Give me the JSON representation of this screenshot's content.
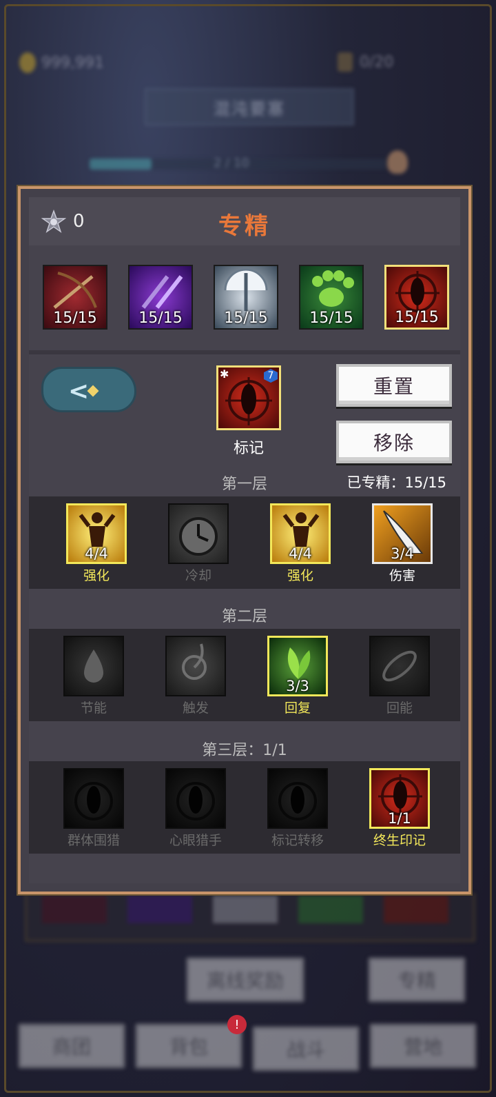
{
  "background": {
    "gold": "999,991",
    "bag": "0/20",
    "stage_title": "混沌要塞",
    "progress_text": "2 / 10",
    "progress_value": 0.2,
    "buttons": {
      "offline_reward": "离线奖励",
      "specialize": "专精"
    },
    "nav": {
      "merchant": "商团",
      "backpack": "背包",
      "battle": "战斗",
      "camp": "营地",
      "badge": "!"
    }
  },
  "panel": {
    "title": "专精",
    "points": "0",
    "classes": [
      {
        "name": "crossbow-class",
        "level": "15/15",
        "selected": false,
        "color": "#6a1420"
      },
      {
        "name": "dagger-class",
        "level": "15/15",
        "selected": false,
        "color": "#4a1a7a"
      },
      {
        "name": "axe-class",
        "level": "15/15",
        "selected": false,
        "color": "#6a7a8a"
      },
      {
        "name": "paw-class",
        "level": "15/15",
        "selected": false,
        "color": "#2a7a2a"
      },
      {
        "name": "hunter-mark-class",
        "level": "15/15",
        "selected": true,
        "color": "#9a1a10"
      }
    ],
    "selected": {
      "label": "标记",
      "badge": "7",
      "snow": "✱"
    },
    "reset_label": "重置",
    "remove_label": "移除",
    "tier1": {
      "label": "第一层",
      "count_label": "已专精：",
      "count": "15/15",
      "talents": [
        {
          "name": "强化",
          "level": "4/4",
          "active": true,
          "color": "#c89a10"
        },
        {
          "name": "冷却",
          "level": "",
          "active": false,
          "color": "#505050"
        },
        {
          "name": "强化",
          "level": "4/4",
          "active": true,
          "color": "#c89a10"
        },
        {
          "name": "伤害",
          "level": "3/4",
          "active": true,
          "color": "#d07a10"
        }
      ]
    },
    "tier2": {
      "label": "第二层",
      "talents": [
        {
          "name": "节能",
          "level": "",
          "active": false,
          "color": "#404040"
        },
        {
          "name": "触发",
          "level": "",
          "active": false,
          "color": "#505050"
        },
        {
          "name": "回复",
          "level": "3/3",
          "active": true,
          "color": "#2a6a1a"
        },
        {
          "name": "回能",
          "level": "",
          "active": false,
          "color": "#404040"
        }
      ]
    },
    "tier3": {
      "label": "第三层：",
      "count": "1/1",
      "talents": [
        {
          "name": "群体围猎",
          "level": "",
          "active": false,
          "color": "#3a3a3a"
        },
        {
          "name": "心眼猎手",
          "level": "",
          "active": false,
          "color": "#3a3a3a"
        },
        {
          "name": "标记转移",
          "level": "",
          "active": false,
          "color": "#3a3a3a"
        },
        {
          "name": "终生印记",
          "level": "1/1",
          "active": true,
          "color": "#9a1a10"
        }
      ]
    }
  }
}
